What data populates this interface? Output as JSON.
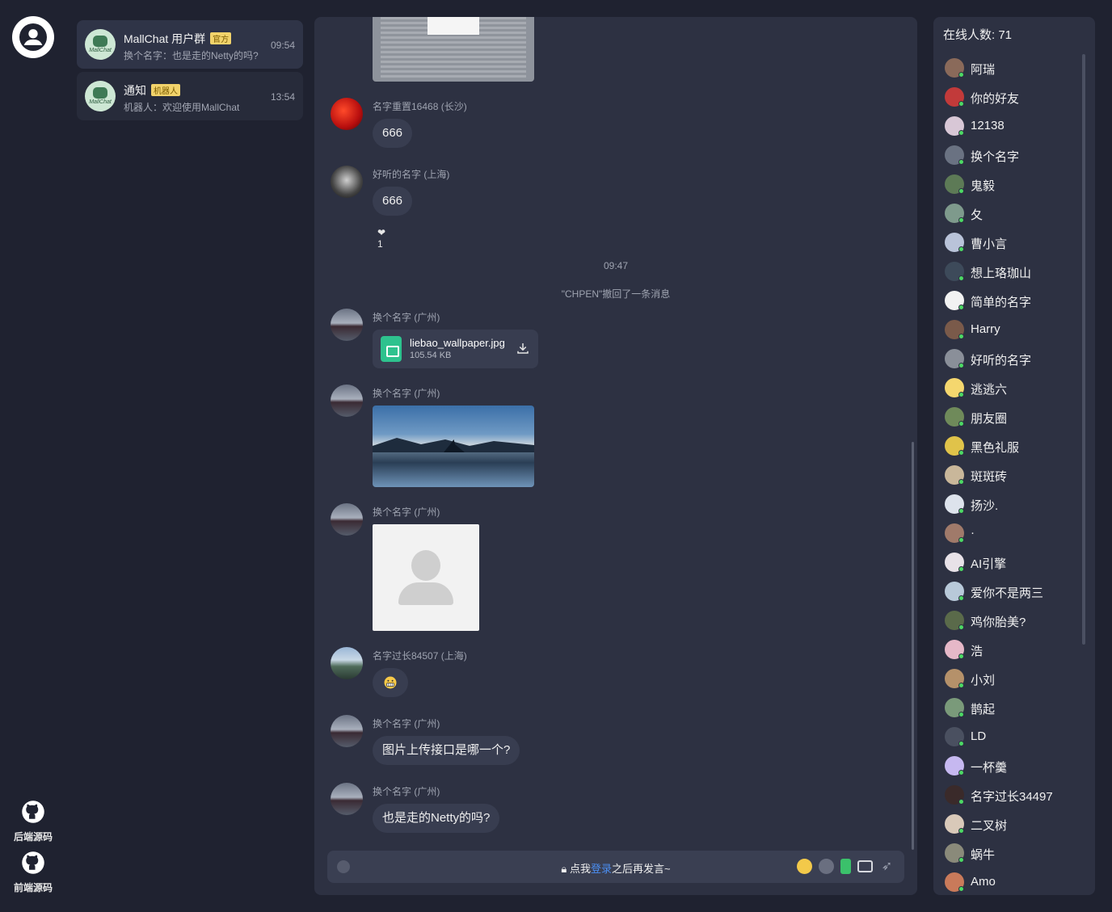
{
  "sidebar": {
    "links": [
      {
        "label": "后端源码",
        "icon": "github-icon"
      },
      {
        "label": "前端源码",
        "icon": "github-icon"
      }
    ]
  },
  "conversations": [
    {
      "name": "MallChat 用户群",
      "tag": "官方",
      "preview": "换个名字：也是走的Netty的吗?",
      "time": "09:54",
      "avatar_text": "MallChat"
    },
    {
      "name": "通知",
      "tag": "机器人",
      "preview": "机器人：欢迎使用MallChat",
      "time": "13:54",
      "avatar_text": "MallChat"
    }
  ],
  "messages": [
    {
      "name": "名字重置16468 (长沙)",
      "text": "666"
    },
    {
      "name": "好听的名字 (上海)",
      "text": "666",
      "likes": "1"
    },
    {
      "time_divider": "09:47"
    },
    {
      "recall_note": "\"CHPEN\"撤回了一条消息"
    },
    {
      "name": "换个名字 (广州)",
      "file": {
        "name": "liebao_wallpaper.jpg",
        "size": "105.54 KB"
      }
    },
    {
      "name": "换个名字 (广州)",
      "image": "landscape-photo"
    },
    {
      "name": "换个名字 (广州)",
      "image": "placeholder-photo"
    },
    {
      "name": "名字过长84507 (上海)",
      "emoji": "grimacing-face"
    },
    {
      "name": "换个名字 (广州)",
      "text": "图片上传接口是哪一个?"
    },
    {
      "name": "换个名字 (广州)",
      "text": "也是走的Netty的吗?"
    }
  ],
  "input": {
    "prefix": "点我",
    "login_link": "登录",
    "suffix": "之后再发言~"
  },
  "online": {
    "title": "在线人数: 71",
    "users": [
      "阿瑞",
      "你的好友",
      "12138",
      "换个名字",
      "鬼毅",
      "夂",
      "曹小言",
      "想上珞珈山",
      "简单的名字",
      "Harry",
      "好听的名字",
      "逃逃六",
      "朋友圈",
      "黑色礼服",
      "斑斑砖",
      "扬沙.",
      "·",
      "AI引擎",
      "爱你不是两三",
      "鸡你胎美?",
      "浩",
      "小刘",
      "鹊起",
      "LD",
      "一杯羹",
      "名字过长34497",
      "二叉树",
      "蜗牛",
      "Amo"
    ]
  },
  "colors": {
    "online_dot": "#4cd964",
    "login_link": "#4b8df0",
    "tag_bg": "#f2d36b"
  }
}
